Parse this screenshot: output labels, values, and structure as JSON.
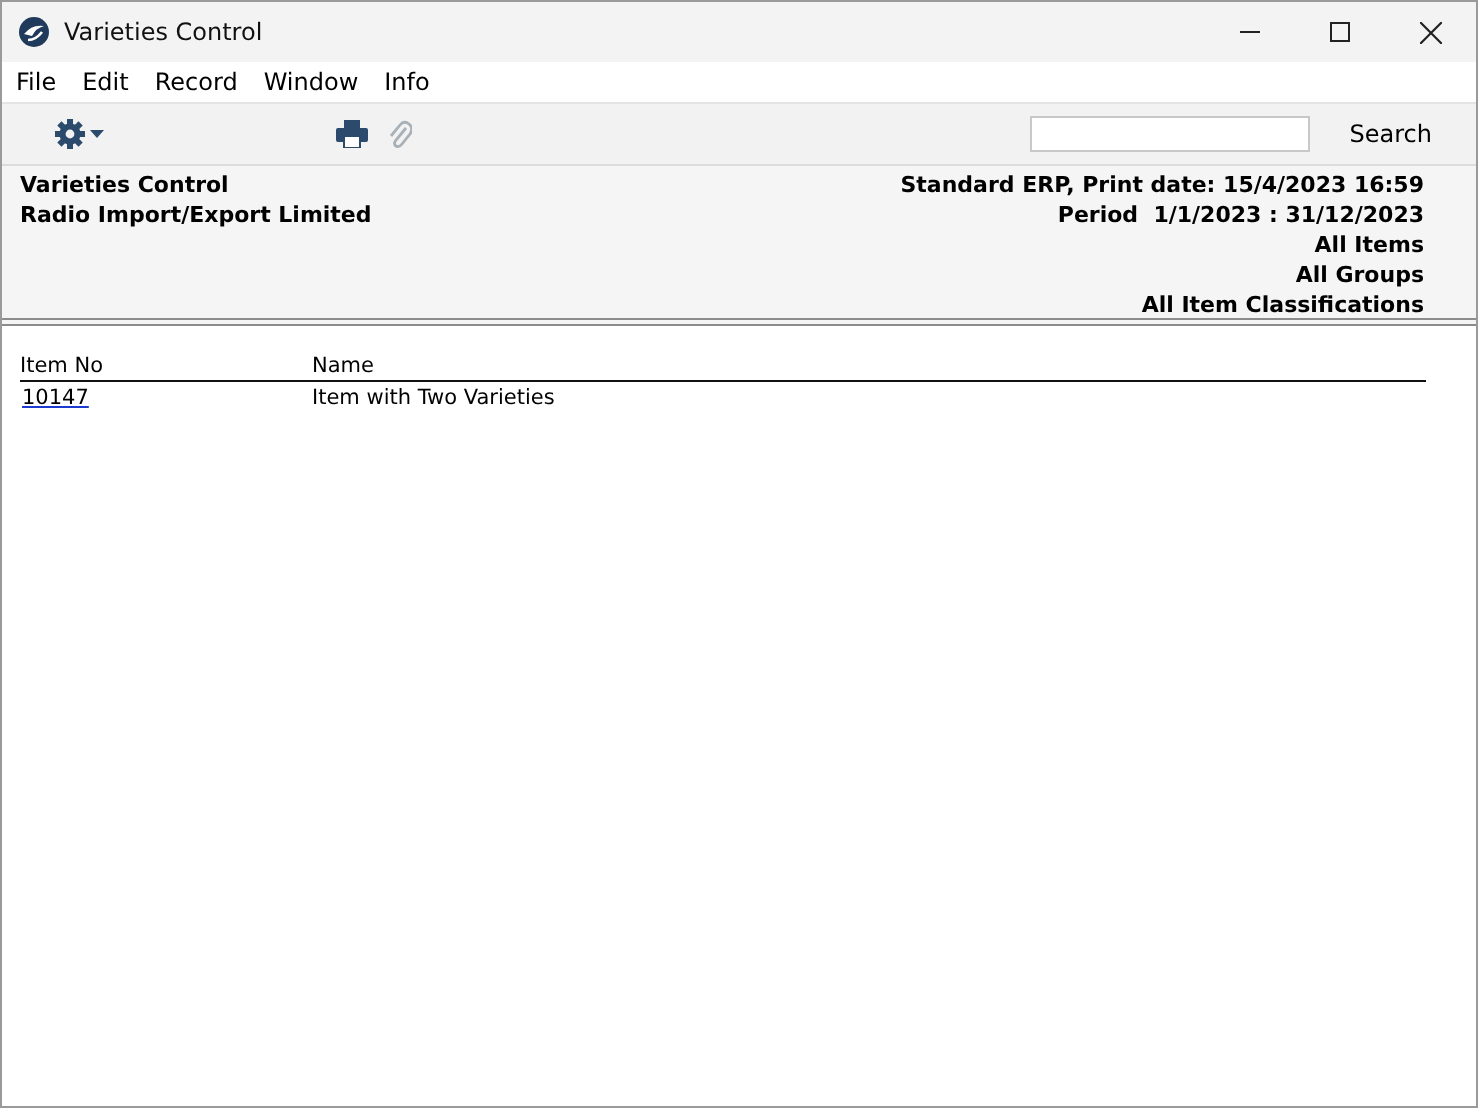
{
  "window": {
    "title": "Varieties Control"
  },
  "menu": [
    "File",
    "Edit",
    "Record",
    "Window",
    "Info"
  ],
  "toolbar": {
    "search_button": "Search"
  },
  "report_header": {
    "left": [
      "Varieties Control",
      "Radio Import/Export Limited"
    ],
    "right": [
      "Standard ERP, Print date: 15/4/2023 16:59",
      "Period  1/1/2023 : 31/12/2023",
      "All Items",
      "All Groups",
      "All Item Classifications"
    ]
  },
  "table": {
    "columns": [
      "Item No",
      "Name"
    ],
    "rows": [
      {
        "cells": [
          "10147",
          "Item with Two Varieties"
        ]
      }
    ]
  }
}
